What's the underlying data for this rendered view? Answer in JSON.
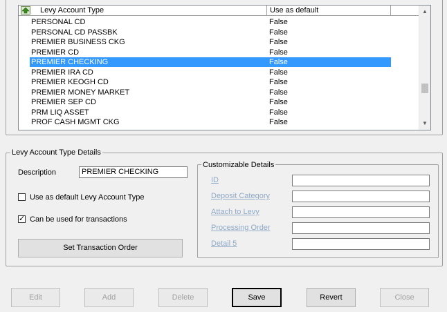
{
  "grid": {
    "columns": [
      "Levy Account Type",
      "Use as default"
    ],
    "rows": [
      {
        "type": "PERSONAL CD",
        "default": "False"
      },
      {
        "type": "PERSONAL CD PASSBK",
        "default": "False"
      },
      {
        "type": "PREMIER BUSINESS CKG",
        "default": "False"
      },
      {
        "type": "PREMIER CD",
        "default": "False"
      },
      {
        "type": "PREMIER CHECKING",
        "default": "False",
        "selected": true
      },
      {
        "type": "PREMIER IRA CD",
        "default": "False"
      },
      {
        "type": "PREMIER KEOGH CD",
        "default": "False"
      },
      {
        "type": "PREMIER MONEY MARKET",
        "default": "False"
      },
      {
        "type": "PREMIER SEP CD",
        "default": "False"
      },
      {
        "type": "PRM LIQ ASSET",
        "default": "False"
      },
      {
        "type": "PROF CASH MGMT CKG",
        "default": "False"
      }
    ],
    "sort_icon": "sort-up-arrow-icon"
  },
  "details": {
    "title": "Levy Account Type Details",
    "description_label": "Description",
    "description_value": "PREMIER CHECKING",
    "use_default_label": "Use as default Levy Account Type",
    "use_default_checked": false,
    "transactions_label": "Can be used for transactions",
    "transactions_checked": true,
    "set_order_button": "Set Transaction Order"
  },
  "custom": {
    "title": "Customizable Details",
    "fields": [
      {
        "label": "ID",
        "value": ""
      },
      {
        "label": "Deposit Category",
        "value": ""
      },
      {
        "label": "Attach to Levy",
        "value": ""
      },
      {
        "label": "Processing Order",
        "value": ""
      },
      {
        "label": "Detail 5",
        "value": ""
      }
    ]
  },
  "buttons": {
    "edit": "Edit",
    "add": "Add",
    "delete": "Delete",
    "save": "Save",
    "revert": "Revert",
    "close": "Close"
  }
}
